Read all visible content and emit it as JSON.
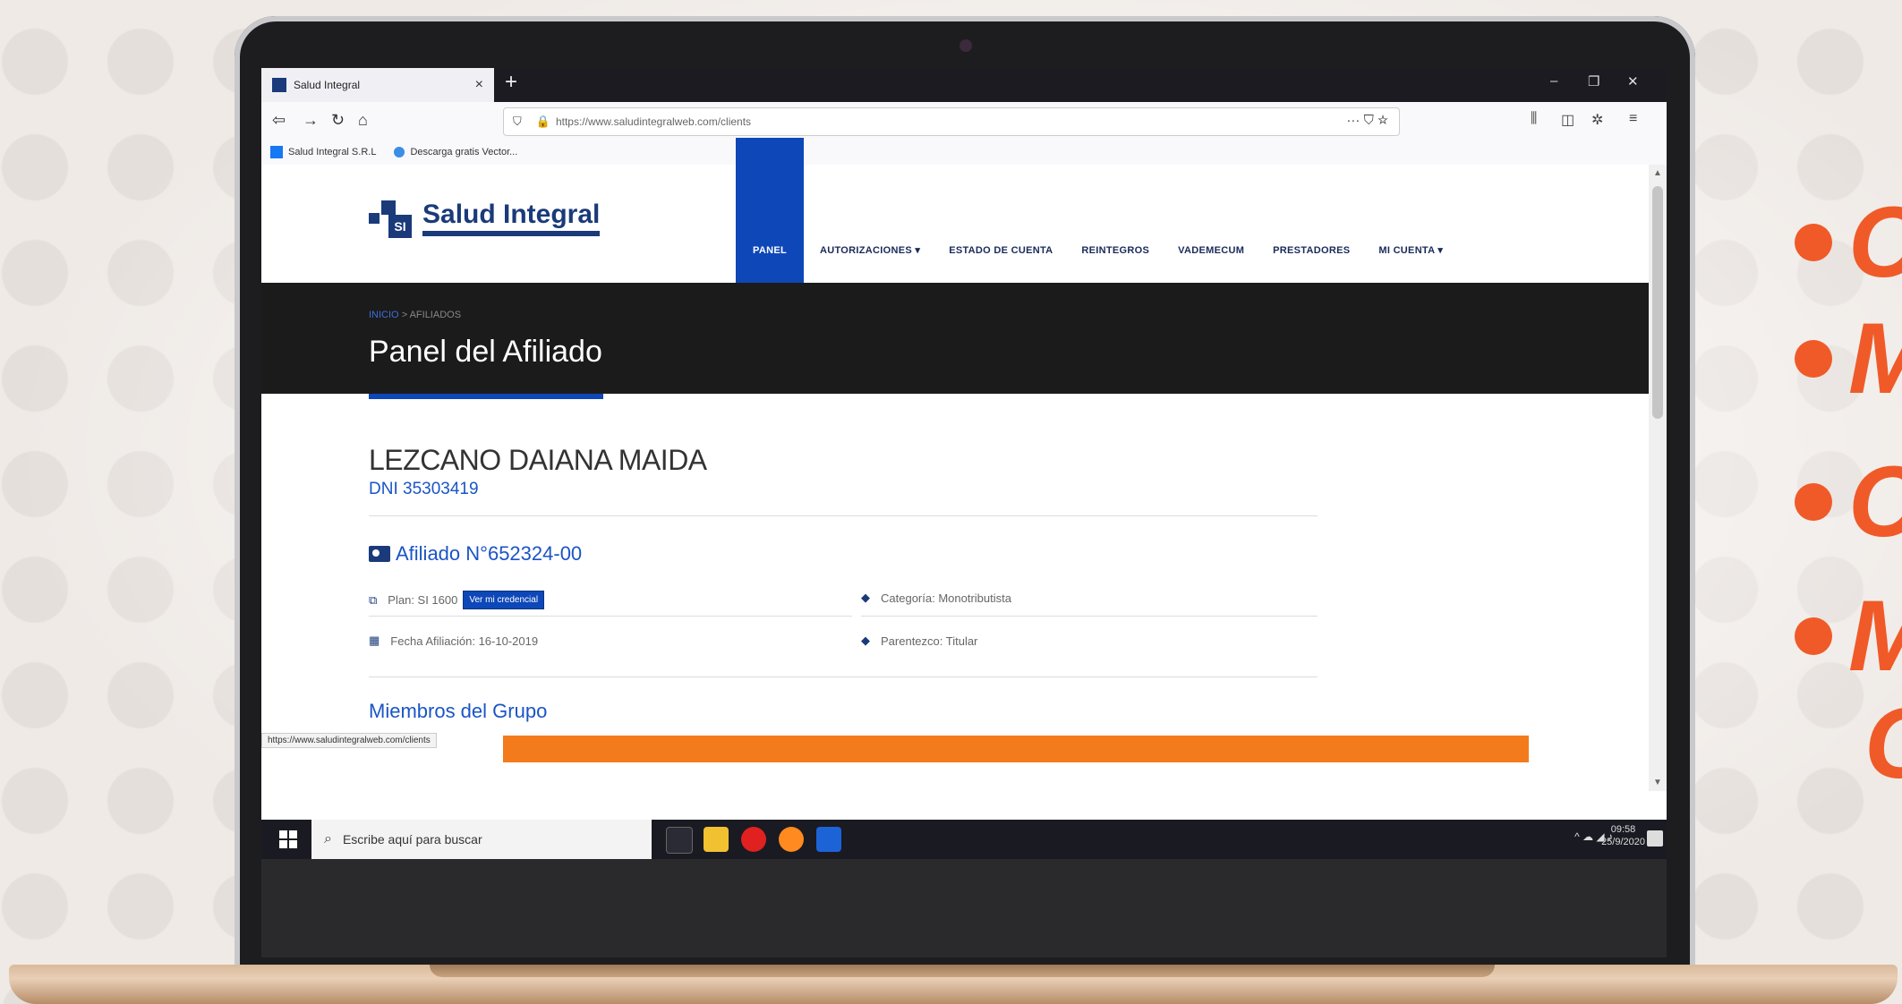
{
  "promo": {
    "accent_color": "#f05a28",
    "bullets": [
      "C",
      "M",
      "C",
      "M",
      "C"
    ]
  },
  "browser": {
    "tab_title": "Salud Integral",
    "tab_close": "×",
    "new_tab": "+",
    "window_controls": {
      "minimize": "–",
      "restore": "❐",
      "close": "✕"
    },
    "url": "https://www.saludintegralweb.com/clients",
    "url_actions": "··· ⛉ ☆",
    "bookmarks": [
      "Salud Integral S.R.L",
      "Descarga gratis Vector..."
    ],
    "status_url": "https://www.saludintegralweb.com/clients"
  },
  "site": {
    "logo_text": "Salud Integral",
    "logo_mark": "SI",
    "nav": [
      "PANEL",
      "AUTORIZACIONES ▾",
      "ESTADO DE CUENTA",
      "REINTEGROS",
      "VADEMECUM",
      "PRESTADORES",
      "MI CUENTA ▾"
    ],
    "breadcrumb": {
      "home": "INICIO",
      "separator": ">",
      "current": "AFILIADOS"
    },
    "page_title": "Panel del Afiliado",
    "member_name": "LEZCANO DAIANA MAIDA",
    "dni": "DNI 35303419",
    "affiliate_number": "Afiliado N°652324-00",
    "fields": {
      "plan": "Plan: SI 1600",
      "credential_button": "Ver mi credencial",
      "fecha": "Fecha Afiliación: 16-10-2019",
      "categoria": "Categoría: Monotributista",
      "parentesco": "Parentezco: Titular"
    },
    "group_title": "Miembros del Grupo",
    "brand_color": "#1a3a7a",
    "accent_blue": "#0d47b8",
    "group_bar_color": "#f47b1b"
  },
  "taskbar": {
    "search_placeholder": "Escribe aquí para buscar",
    "time": "09:58",
    "date": "25/9/2020",
    "tray": "^ ☁ ◢ ♪"
  }
}
